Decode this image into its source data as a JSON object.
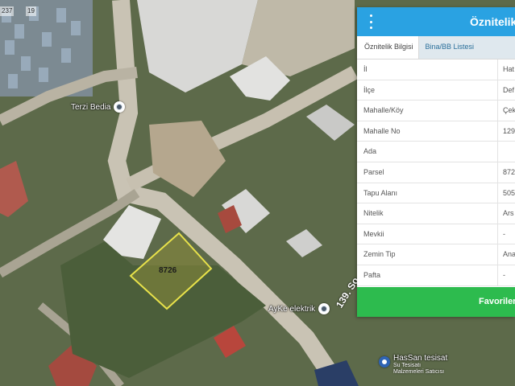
{
  "map": {
    "corner_labels": [
      "237",
      "19"
    ],
    "pois": [
      {
        "label": "Terzi Bedia"
      },
      {
        "label": "AyKe elektrik"
      }
    ],
    "parcel_label": "8726",
    "street_label": "139. So",
    "hassan": {
      "title": "HasSan tesisat",
      "line1": "Su Tesisatı",
      "line2": "Malzemeleri Satıcısı"
    },
    "colors": {
      "parcel_outline": "#e8e24a",
      "poi_blue": "#2f64b4"
    }
  },
  "panel": {
    "title": "Öznitelik",
    "menu_icon": "kebab-menu-icon",
    "tabs": [
      {
        "label": "Öznitelik Bilgisi",
        "active": true
      },
      {
        "label": "Bina/BB Listesi",
        "active": false
      }
    ],
    "rows": [
      {
        "key": "İl",
        "value": "Hat"
      },
      {
        "key": "İlçe",
        "value": "Def"
      },
      {
        "key": "Mahalle/Köy",
        "value": "Çek"
      },
      {
        "key": "Mahalle No",
        "value": "129"
      },
      {
        "key": "Ada",
        "value": ""
      },
      {
        "key": "Parsel",
        "value": "872"
      },
      {
        "key": "Tapu Alanı",
        "value": "505"
      },
      {
        "key": "Nitelik",
        "value": "Ars"
      },
      {
        "key": "Mevkii",
        "value": "-"
      },
      {
        "key": "Zemin Tip",
        "value": "Ana"
      },
      {
        "key": "Pafta",
        "value": "-"
      }
    ],
    "favorite_button": "Favorilere",
    "colors": {
      "header": "#2aa2e2",
      "button": "#2dbb4e"
    }
  }
}
